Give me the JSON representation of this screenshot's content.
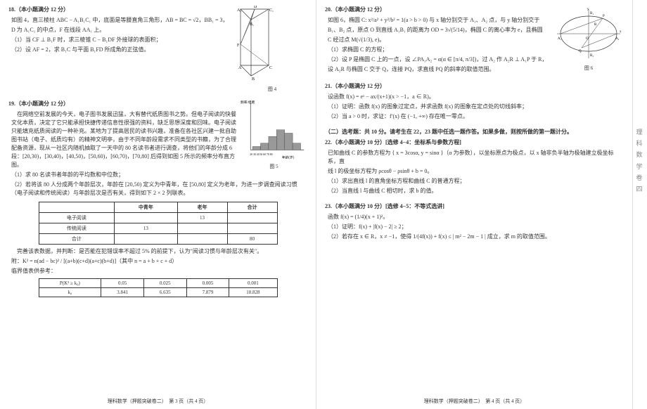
{
  "page_left": {
    "footer": "理科数学（押题突破卷二）　第 3 页（共 4 页）",
    "p18": {
      "header": "18.（本小题满分 12 分）",
      "intro": "如图 4，直三棱柱 ABC − A₁B₁C₁ 中，底面是等腰直角三角形，AB = BC = √2，BB₁ = 3，",
      "line2": "D 为 A₁C₁ 的中点，F 在线段 AA₁ 上。",
      "q1": "（1）当 CF ⊥ B₁F 时，求三棱锥 C − B₁DF 外接球的表面积；",
      "q2": "（2）设 AF = 2，求 B₁C 与平面 B₁FD 所成角的正弦值。",
      "fig_caption": "图 4"
    },
    "p19": {
      "header": "19.（本小题满分 12 分）",
      "para1": "在网络空前发展的今天，电子图书发展迅猛，大有替代纸质图书之势。但电子阅读的快餐文化本质，决定了它只能承担快捷传递信息性很强的资料，缺乏思想深度和回味。电子阅读只能填充纸质阅读的一种补充。某地为了提高居民的读书兴趣，准备在各社区兴建一批自助图书站（电子、纸质均有）的精神文明亭，由于不同年龄段需求不同类型的书籍，为了合理配备资源，现从一社区内随机抽取了一天中的 80 名读书者进行调查，将他们的年龄分成 6 段：[20,30)，[30,40)，[40,50)，[50,60)，[60,70)，[70,80] 后得到如图 5 所示的频率分布直方图。",
      "q1": "（1）求 80 名读书者年龄的平均数和中位数；",
      "q2": "（2）若将该 80 人分成两个年龄层次，年龄在 [20,50) 定义为中青年，在 [50,80] 定义为老年，为进一步调查阅读习惯（电子阅读和传统阅读）与年龄层次是否有关，得到如下 2 × 2 列联表。",
      "table1_head_c1": "",
      "table1_head_c2": "中青年",
      "table1_head_c3": "老年",
      "table1_head_c4": "合计",
      "table1_r1_c1": "电子阅读",
      "table1_r1_c3": "13",
      "table1_r2_c1": "传统阅读",
      "table1_r2_c2": "13",
      "table1_r3_c1": "合计",
      "table1_r3_c4": "80",
      "para2": "完善该表数据，并判断：是否能在犯错误率不超过 5% 的前提下，认为\"阅读习惯与年龄层次有关\"。",
      "formula": "附：K² = n(ad − bc)² / [(a+b)(c+d)(a+c)(b+d)]（其中 n = a + b + c + d）",
      "ref_label": "临界值表供参考：",
      "table2_h1": "P(K² ≥ k₀)",
      "table2_h2": "0.05",
      "table2_h3": "0.025",
      "table2_h4": "0.005",
      "table2_h5": "0.001",
      "table2_r1": "k₀",
      "table2_r2": "3.841",
      "table2_r3": "6.635",
      "table2_r4": "7.879",
      "table2_r5": "10.828",
      "fig_caption": "图 5",
      "hist_axis": "年龄(岁)",
      "hist_y": "频率/组距"
    }
  },
  "page_right": {
    "footer": "理科数学（押题突破卷二）　第 4 页（共 4 页）",
    "p20": {
      "header": "20.（本小题满分 12 分）",
      "line1": "如图 6，椭圆 C: x²/a² + y²/b² = 1(a > b > 0) 与 x 轴分别交于 A₁、A₂ 点，与 y 轴分别交于",
      "line2": "B₁、B₂ 点，原点 O 到直线 A₁B₁ 的距离为 OD = 3√(5/14)，椭圆 C 的离心率为 e，且椭圆",
      "line3": "C 经过点 M(√(1/3), e)。",
      "q1": "（1）求椭圆 C 的方程；",
      "q2": "（2）设 P 是椭圆 C 上的一点，设 ∠PA₁A₂ = α(α ∈ [π/4, π/3])，过 A₂ 作 A₂R ⊥ A₁P 于 R，",
      "line4": "设 A₂R 与椭圆 C 交于 Q，连接 PQ，求直线 PQ 的斜率的取值范围。",
      "fig_caption": "图 6"
    },
    "p21": {
      "header": "21.（本小题满分 12 分）",
      "intro": "设函数 f(x) = eˣ − ax/(x+1)(x > −1，a ∈ R)。",
      "q1": "（1）证明：函数 f(x) 的图象过定点，并求函数 f(x) 的图象在定点处的切线斜率；",
      "q2": "（2）当 a > 0 时，求证：f′(x) 在 (−1, +∞) 存在唯一零点。"
    },
    "section2_title": "（二）选考题：共 10 分。请考生在 22，23 题中任选一题作答。如果多做，则按所做的第一题计分。",
    "p22": {
      "header": "22.（本小题满分 10 分）[选修 4−4：坐标系与参数方程]",
      "line1": "已知曲线 C 的参数方程为 { x = 3cosα, y = sinα }（α 为参数），以坐标原点为极点，以 x 轴非负半轴为极轴建立极坐标系，直",
      "line2": "线 l 的极坐标方程为 ρcosθ − ρsinθ + b = 0。",
      "q1": "（1）求出直线 l 的直角坐标方程和曲线 C 的普通方程；",
      "q2": "（2）当直线 l 与曲线 C 相切时，求 b 的值。"
    },
    "p23": {
      "header": "23.（本小题满分 10 分）[选修 4−5：不等式选讲]",
      "intro": "函数 f(x) = (1/4)(x + 1)²。",
      "q1": "（1）证明：f(x) + |f(x) − 2| ≥ 2；",
      "q2": "（2）若存在 x ∈ R，x ≠ −1，使得 1/(4f(x)) + f(x) ≤ | m² − 2m − 1 | 成立，求 m 的取值范围。"
    }
  },
  "side_tab": [
    "理",
    "科",
    "数",
    "学",
    "卷",
    "四"
  ],
  "chart_data": {
    "type": "bar",
    "title": "",
    "xlabel": "年龄(岁)",
    "ylabel": "频率/组距",
    "categories": [
      "20",
      "30",
      "40",
      "50",
      "60",
      "70",
      "80"
    ],
    "bin_edges": [
      20,
      30,
      40,
      50,
      60,
      70,
      80
    ],
    "values_estimated": [
      0.005,
      0.01,
      0.02,
      0.03,
      0.025,
      0.01
    ]
  }
}
